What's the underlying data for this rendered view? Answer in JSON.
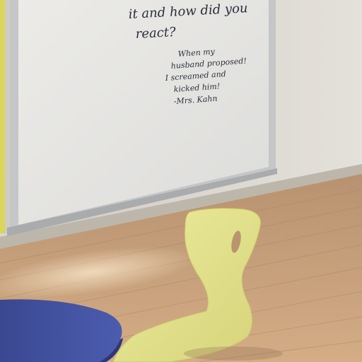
{
  "whiteboard": {
    "question_line_1": "it and how did you",
    "question_line_2": "react?",
    "answer_line_1": "When my",
    "answer_line_2": "husband proposed!",
    "answer_line_3": "I screamed and",
    "answer_line_4": "kicked him!",
    "answer_signature": "-Mrs. Kahn"
  },
  "colors": {
    "wall": "#dedbd3",
    "whiteboard": "#e6e6e4",
    "whiteboard_frame": "#c4c6c8",
    "floor": "#c9a27a",
    "chair": "#e6e48e",
    "table_top": "#3f4f9e",
    "accent_yellow": "#d9d65a"
  }
}
